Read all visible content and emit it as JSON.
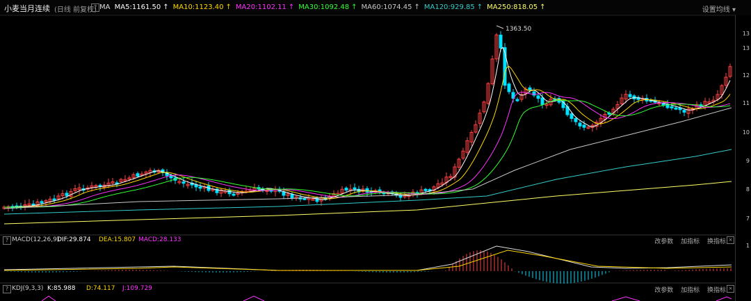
{
  "header": {
    "title": "小麦当月连续",
    "subtitle": "(日线 前复权)",
    "help": "?",
    "ma_label": "MA",
    "settings_label": "设置均线"
  },
  "ma_values": [
    {
      "label": "MA5:1161.50",
      "color": "#ffffff"
    },
    {
      "label": "MA10:1123.40",
      "color": "#ffd700"
    },
    {
      "label": "MA20:1102.11",
      "color": "#ff33ff"
    },
    {
      "label": "MA30:1092.48",
      "color": "#33ff33"
    },
    {
      "label": "MA60:1074.45",
      "color": "#c8c8c8"
    },
    {
      "label": "MA120:929.85",
      "color": "#33cccc"
    },
    {
      "label": "MA250:818.05",
      "color": "#ffff66"
    }
  ],
  "price_axis": [
    "13",
    "13",
    "12",
    "11",
    "10",
    "9",
    "8",
    "7"
  ],
  "peak_label": "1363.50",
  "macd": {
    "name": "MACD(12,26,9)",
    "dif": "DIF:29.874",
    "dea": "DEA:15.807",
    "macd": "MACD:28.133",
    "axis_label": "1"
  },
  "kdj": {
    "name": "KDJ(9,3,3)",
    "k": "K:85.988",
    "d": "D:74.117",
    "j": "J:109.729"
  },
  "panel_actions": {
    "change": "改参数",
    "add": "加指标",
    "switch": "换指标",
    "close": "×"
  },
  "colors": {
    "up": "#ff4040",
    "down": "#00e0ff",
    "ma5": "#ffffff",
    "ma10": "#ffd700",
    "ma20": "#ff33ff",
    "ma30": "#33ff33",
    "ma60": "#c8c8c8",
    "ma120": "#33cccc",
    "ma250": "#ffff66"
  }
}
